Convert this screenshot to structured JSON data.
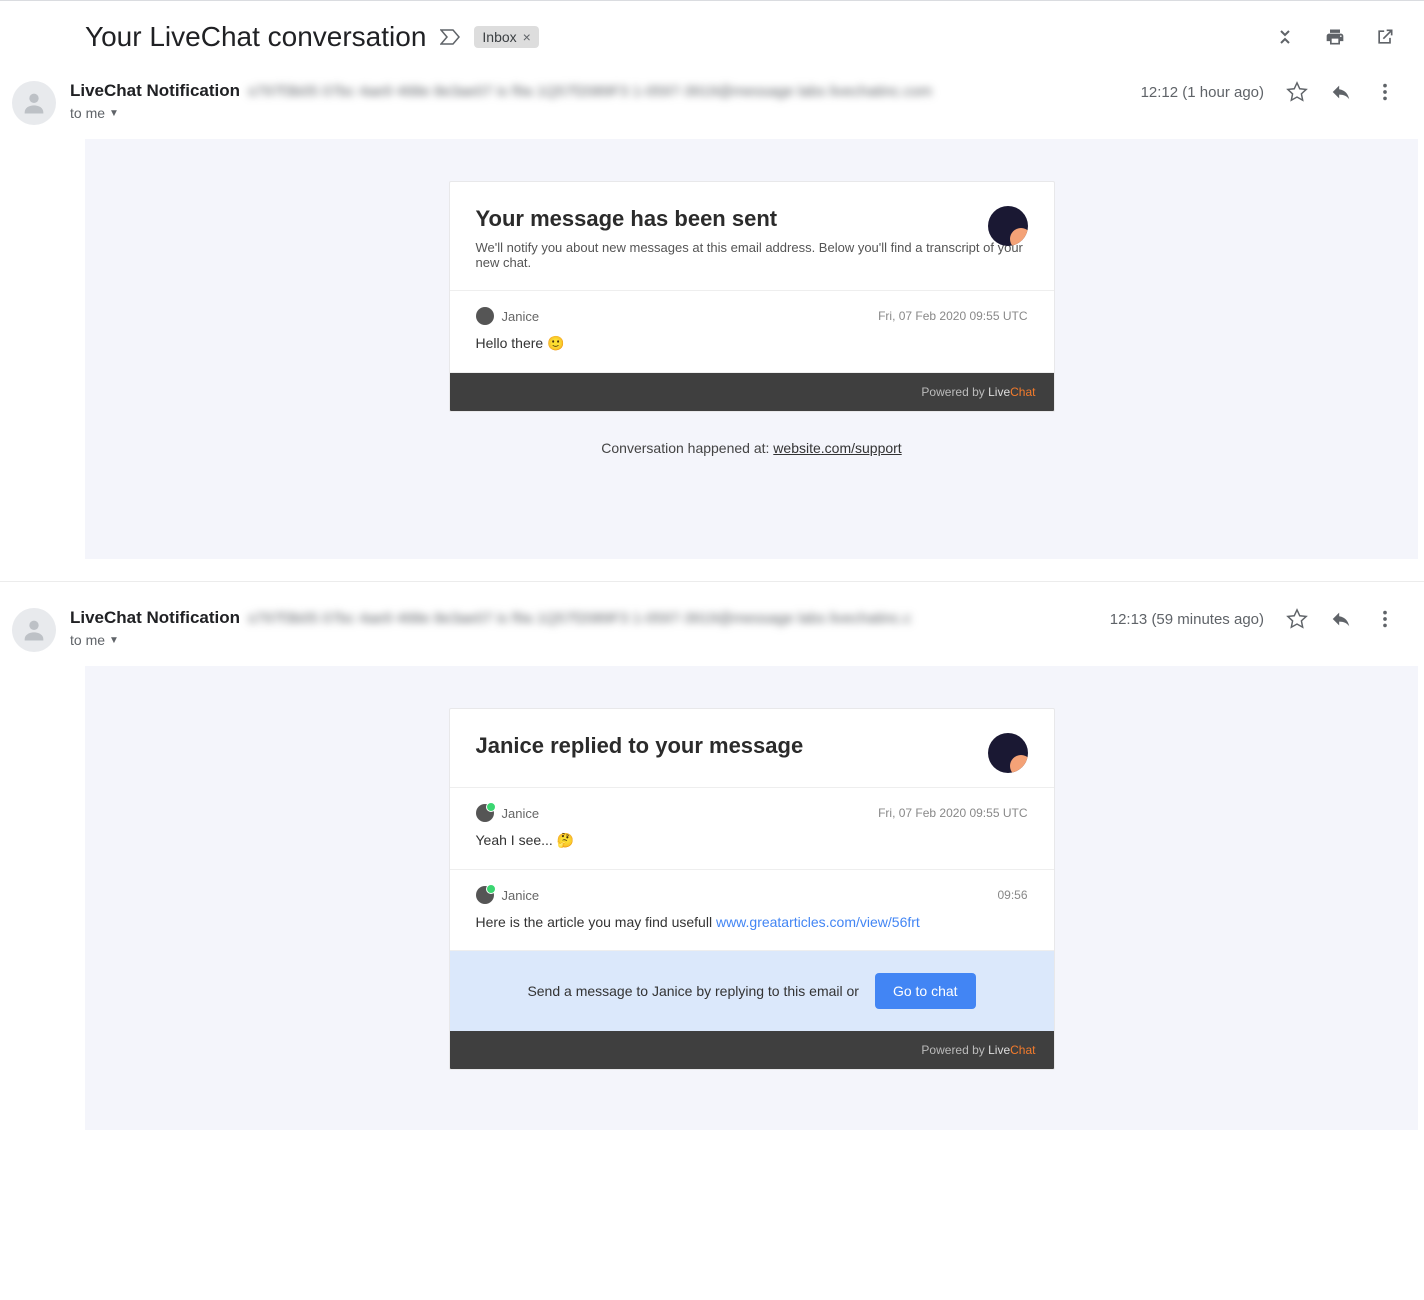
{
  "header": {
    "subject": "Your LiveChat conversation",
    "chip": "Inbox"
  },
  "messages": [
    {
      "sender": "LiveChat Notification",
      "sender_email_blur": "s797f3b05 07bc 4ae9 468e 8e3ae07 is f9a 1Q57f2089F3 1-0597-3919@message labs livechatinc.com",
      "to": "to me",
      "time": "12:12 (1 hour ago)",
      "card": {
        "title": "Your message has been sent",
        "subtitle": "We'll notify you about new messages at this email address. Below you'll find a transcript of your new chat.",
        "items": [
          {
            "author": "Janice",
            "time": "Fri, 07 Feb 2020 09:55 UTC",
            "text": "Hello there 🙂",
            "online": false
          }
        ],
        "footer_prefix": "Powered by ",
        "footer_live": "Live",
        "footer_chat": "Chat"
      },
      "below_prefix": "Conversation happened at: ",
      "below_link": "website.com/support"
    },
    {
      "sender": "LiveChat Notification",
      "sender_email_blur": "s797f3b05 07bc 4ae9 468e 8e3ae07 is f9a 1Q57f2089F3 1-0597-3919@message labs livechatinc.c",
      "to": "to me",
      "time": "12:13 (59 minutes ago)",
      "card": {
        "title": "Janice replied to your message",
        "subtitle": "",
        "items": [
          {
            "author": "Janice",
            "time": "Fri, 07 Feb 2020 09:55 UTC",
            "text": "Yeah I see... 🤔",
            "online": true
          },
          {
            "author": "Janice",
            "time": "09:56",
            "text": "Here is the article you may find usefull ",
            "link": "www.greatarticles.com/view/56frt",
            "online": true
          }
        ],
        "reply_text": "Send a message to Janice by replying to this email or",
        "reply_btn": "Go to chat",
        "footer_prefix": "Powered by ",
        "footer_live": "Live",
        "footer_chat": "Chat"
      }
    }
  ]
}
